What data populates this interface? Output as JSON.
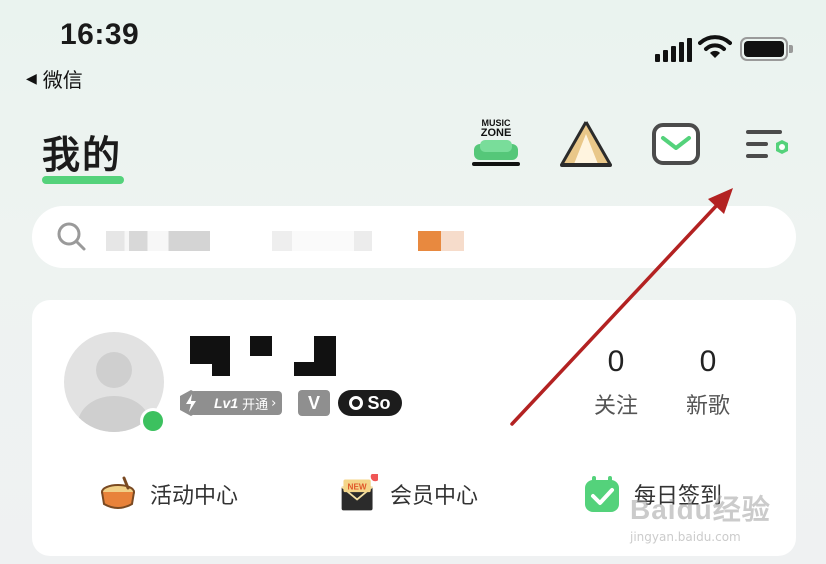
{
  "status_bar": {
    "time": "16:39",
    "back_app": "微信",
    "back_glyph": "◀"
  },
  "header": {
    "title": "我的",
    "music_zone_line1": "MUSIC",
    "music_zone_line2": "ZONE",
    "accent": "#54d27b"
  },
  "profile": {
    "level_badge": "Lv1",
    "level_action": "开通",
    "vip_letter": "V",
    "so_badge": "So",
    "stats": [
      {
        "value": "0",
        "label": "关注"
      },
      {
        "value": "0",
        "label": "新歌"
      }
    ]
  },
  "activities": [
    {
      "label": "活动中心",
      "icon": "drum-icon"
    },
    {
      "label": "会员中心",
      "icon": "new-envelope-icon"
    },
    {
      "label": "每日签到",
      "icon": "calendar-check-icon"
    }
  ],
  "watermark": {
    "main": "Baidu经验",
    "url": "jingyan.baidu.com"
  }
}
